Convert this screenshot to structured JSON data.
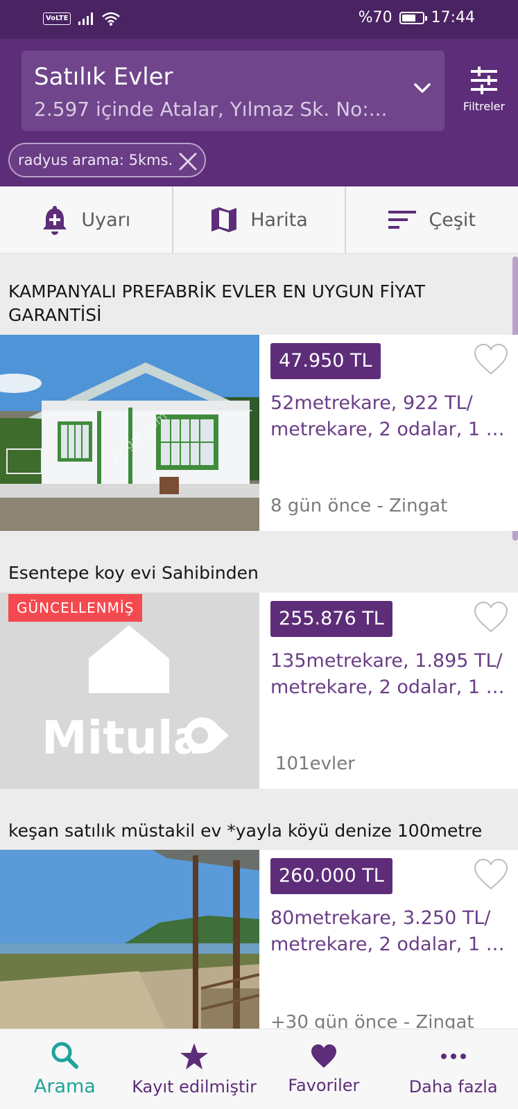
{
  "status_bar": {
    "network": "VoLTE",
    "battery_percent": "%70",
    "battery_level": 0.7,
    "time": "17:44"
  },
  "header": {
    "title": "Satılık Evler",
    "subtitle": "2.597 içinde Atalar, Yılmaz Sk. No:...",
    "filters_label": "Filtreler",
    "chip_label": "radyus arama:  5kms."
  },
  "actions": [
    {
      "label": "Uyarı",
      "icon": "bell-plus-icon"
    },
    {
      "label": "Harita",
      "icon": "map-icon"
    },
    {
      "label": "Çeşit",
      "icon": "sort-icon"
    }
  ],
  "listings": [
    {
      "title": "KAMPANYALI PREFABRİK EVLER EN UYGUN FİYAT GARANTİSİ",
      "price": "47.950 TL",
      "details_line1": "52metrekare, 922 TL/",
      "details_line2": "metrekare, 2 odalar, 1 t...",
      "meta": "8 gün önce  - Zingat",
      "watermark": "zingat.com"
    },
    {
      "title": "Esentepe koy evi Sahibinden",
      "badge": "GÜNCELLENMİŞ",
      "price": "255.876 TL",
      "details_line1": "135metrekare, 1.895 TL/",
      "details_line2": "metrekare, 2 odalar, 1 t...",
      "meta": "101evler",
      "placeholder_logo": "Mitula"
    },
    {
      "title": "keşan satılık müstakil ev *yayla köyü denize 100metre",
      "price": "260.000 TL",
      "details_line1": "80metrekare, 3.250 TL/",
      "details_line2": "metrekare, 2 odalar, 1 t...",
      "meta": "+30 gün önce  - Zingat"
    }
  ],
  "bottom_nav": [
    {
      "label": "Arama",
      "icon": "search-icon",
      "active": true
    },
    {
      "label": "Kayıt edilmiştir",
      "icon": "star-icon",
      "active": false
    },
    {
      "label": "Favoriler",
      "icon": "heart-icon",
      "active": false
    },
    {
      "label": "Daha fazla",
      "icon": "more-icon",
      "active": false
    }
  ],
  "colors": {
    "primary": "#5d2d79",
    "status_bar": "#4a2363",
    "accent_active": "#1fa39a",
    "badge": "#f4494f"
  }
}
